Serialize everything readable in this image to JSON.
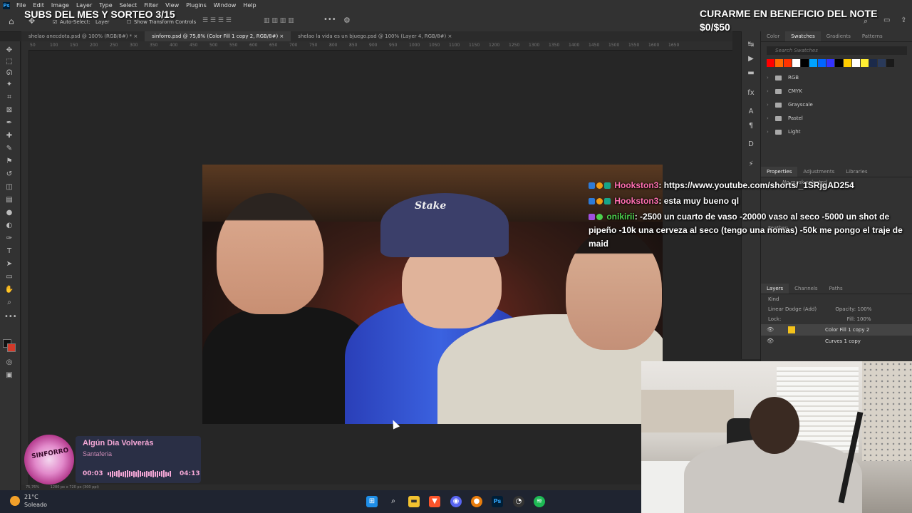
{
  "menubar": {
    "app_icon_text": "Ps",
    "items": [
      "File",
      "Edit",
      "Image",
      "Layer",
      "Type",
      "Select",
      "Filter",
      "View",
      "Plugins",
      "Window",
      "Help"
    ]
  },
  "options_bar": {
    "auto_select_label": "Auto-Select:",
    "auto_select_value": "Layer",
    "show_transform_label": "Show Transform Controls"
  },
  "doc_tabs": [
    "shelao anecdota.psd @ 100% (RGB/8#) *",
    "sinforro.psd @ 75,8% (Color Fill 1 copy 2, RGB/8#)",
    "shelao la vida es un bjuego.psd @ 100% (Layer 4, RGB/8#)"
  ],
  "ruler_ticks": [
    "50",
    "100",
    "150",
    "200",
    "250",
    "300",
    "350",
    "400",
    "450",
    "500",
    "550",
    "600",
    "650",
    "700",
    "750",
    "800",
    "850",
    "900",
    "950",
    "1000",
    "1050",
    "1100",
    "1150",
    "1200",
    "1250",
    "1300",
    "1350",
    "1400",
    "1450",
    "1500",
    "1550",
    "1600",
    "1650"
  ],
  "swatches_panel": {
    "tabs": [
      "Color",
      "Swatches",
      "Gradients",
      "Patterns"
    ],
    "search_placeholder": "Search Swatches",
    "colors": [
      "#ff0000",
      "#ff6a00",
      "#ff3300",
      "#ffffff",
      "#000000",
      "#00a2ff",
      "#0066ff",
      "#3333ff",
      "#000000",
      "#ffcc00",
      "#ffffff",
      "#ffee33",
      "#1b2a4a",
      "#2a3a5a",
      "#1a1a1a"
    ],
    "folders": [
      "RGB",
      "CMYK",
      "Grayscale",
      "Pastel",
      "Light"
    ]
  },
  "properties_panel": {
    "tabs": [
      "Properties",
      "Adjustments",
      "Libraries"
    ],
    "no_mask": "No mask selected",
    "feather_label": "Feather:"
  },
  "layers_panel": {
    "tabs": [
      "Layers",
      "Channels",
      "Paths"
    ],
    "kind_label": "Kind",
    "blend_mode": "Linear Dodge (Add)",
    "opacity_label": "Opacity:",
    "opacity_value": "100%",
    "lock_label": "Lock:",
    "fill_label": "Fill:",
    "fill_value": "100%",
    "layers": [
      "Color Fill 1 copy 2",
      "Curves 1 copy"
    ]
  },
  "thumbnail": {
    "cap_logo": "Stake"
  },
  "overlays": {
    "sub_goal": "SUBS DEL MES Y SORTEO 3/15",
    "donation_title": "CURARME EN BENEFICIO DEL NOTE",
    "donation_progress": "$0/$50"
  },
  "chat": [
    {
      "user": "Hookston3",
      "message": ": https://www.youtube.com/shorts/_1SRjgAD254",
      "user_color": "#ff6fb0"
    },
    {
      "user": "Hookston3",
      "message": ": esta muy bueno ql",
      "user_color": "#ff6fb0"
    },
    {
      "user": "onikirii",
      "message": ": -2500 un cuarto de vaso -20000 vaso al seco -5000 un shot de pipeño -10k una cerveza al seco (tengo una nomas) -50k me pongo el traje de maid",
      "user_color": "#4dd24d"
    }
  ],
  "music": {
    "album_text": "SINFORRO",
    "title": "Algún Dia Volverás",
    "artist": "Santaferia",
    "time_current": "00:03",
    "time_total": "04:13"
  },
  "status_bar": {
    "zoom": "75,76%",
    "doc_size": "1280 px x 720 px (300 ppi)"
  },
  "taskbar": {
    "weather_temp": "21°C",
    "weather_desc": "Soleado",
    "icons": [
      "windows-icon",
      "search-icon",
      "file-explorer-icon",
      "brave-icon",
      "discord-icon",
      "blender-icon",
      "photoshop-icon",
      "obs-icon",
      "spotify-icon"
    ]
  }
}
